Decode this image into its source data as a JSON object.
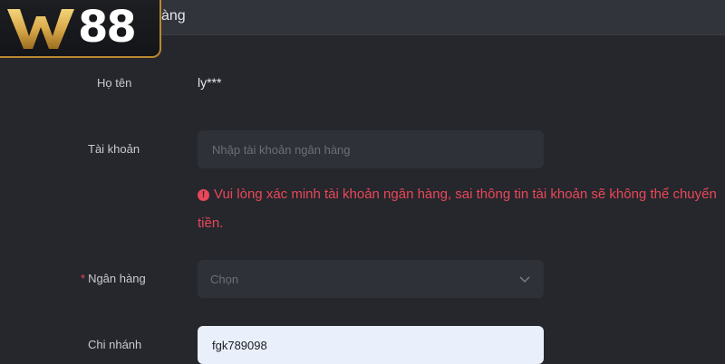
{
  "header": {
    "title": "àng"
  },
  "logo": {
    "text": "W88"
  },
  "form": {
    "full_name": {
      "label": "Họ tên",
      "value": "ly***"
    },
    "account": {
      "label": "Tài khoản",
      "placeholder": "Nhập tài khoản ngân hàng",
      "value": ""
    },
    "error": {
      "icon": "exclamation-circle-icon",
      "message": "Vui lòng xác minh tài khoản ngân hàng, sai thông tin tài khoản sẽ không thể chuyển tiền.",
      "color": "#e8475a"
    },
    "bank": {
      "required_mark": "*",
      "label": "Ngân hàng",
      "placeholder": "Chọn",
      "icon": "chevron-down-icon"
    },
    "branch": {
      "label": "Chi nhánh",
      "value": "fgk789098"
    }
  },
  "colors": {
    "background": "#26272c",
    "field": "#2f3138",
    "accent_gold": "#b8892e",
    "error": "#e8475a"
  }
}
